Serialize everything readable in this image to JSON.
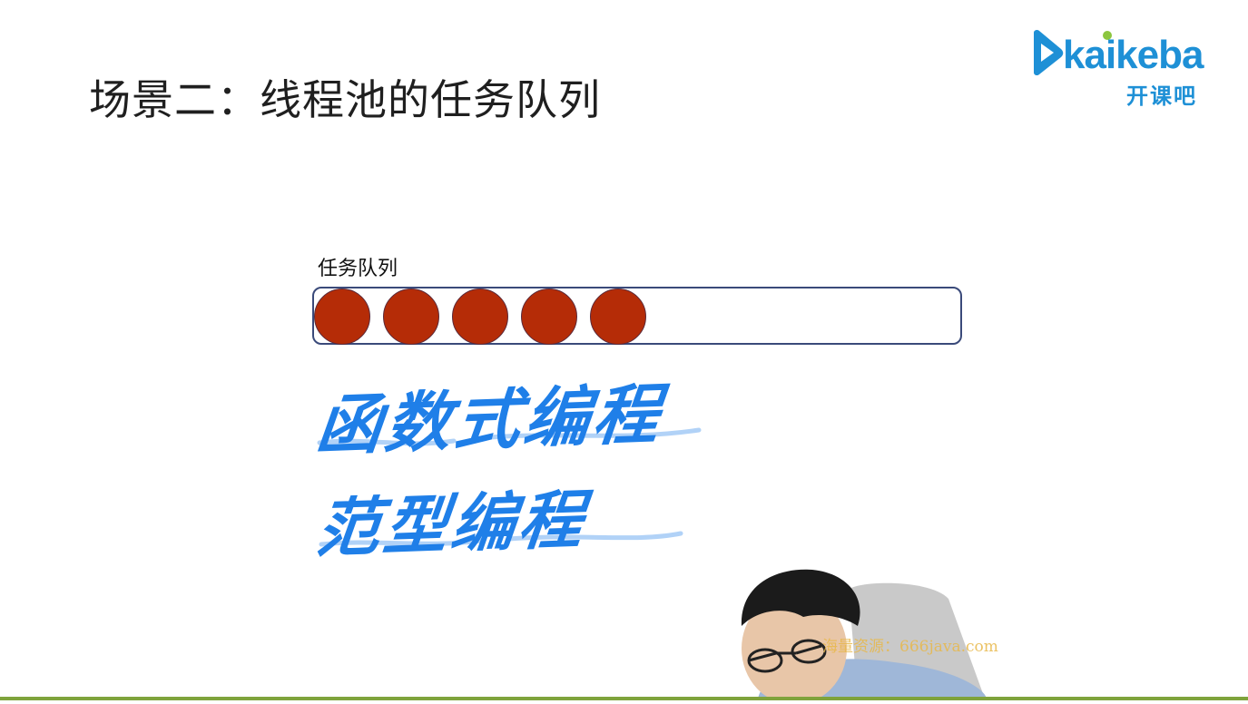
{
  "slide": {
    "title": "场景二：线程池的任务队列"
  },
  "logo": {
    "wordmark": "kaikeba",
    "subtitle": "开课吧",
    "brand_color": "#1e90d6"
  },
  "queue": {
    "label": "任务队列",
    "ball_count": 5,
    "ball_color": "#b52c07",
    "border_color": "#3a4a7a"
  },
  "annotations": {
    "line1": "函数式编程",
    "line2": "范型编程",
    "ink_color": "#1f7fe8"
  },
  "watermark": {
    "text": "海量资源：666java.com"
  }
}
